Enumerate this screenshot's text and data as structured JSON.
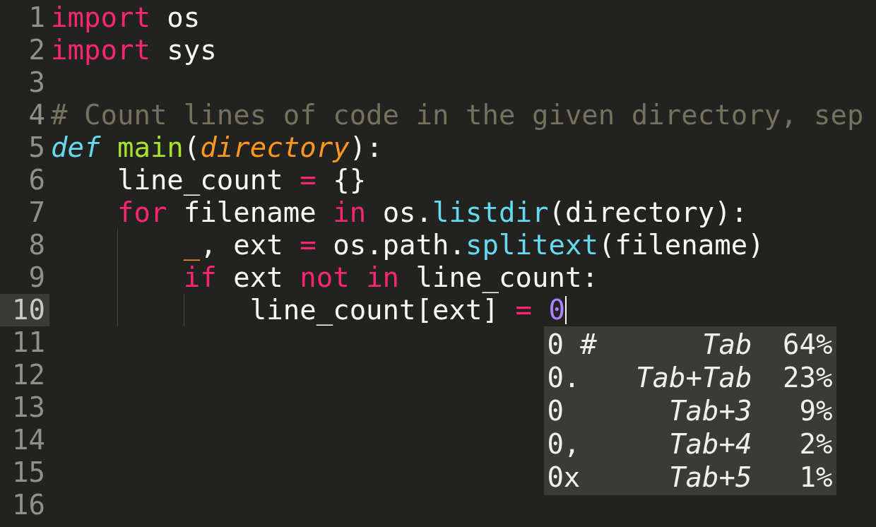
{
  "editor": {
    "lines": [
      {
        "number": "1",
        "current": false,
        "tokens": [
          {
            "text": "import",
            "kind": "keyword"
          },
          {
            "text": " os",
            "kind": "plain"
          }
        ]
      },
      {
        "number": "2",
        "current": false,
        "tokens": [
          {
            "text": "import",
            "kind": "keyword"
          },
          {
            "text": " sys",
            "kind": "plain"
          }
        ]
      },
      {
        "number": "3",
        "current": false
      },
      {
        "number": "4",
        "current": false,
        "tokens": [
          {
            "text": "# Count lines of code in the given directory, sep",
            "kind": "comment"
          }
        ]
      },
      {
        "number": "5",
        "current": false,
        "tokens": [
          {
            "text": "def ",
            "kind": "storage"
          },
          {
            "text": "main",
            "kind": "function"
          },
          {
            "text": "(",
            "kind": "plain"
          },
          {
            "text": "directory",
            "kind": "parameter"
          },
          {
            "text": "):",
            "kind": "plain"
          }
        ]
      },
      {
        "number": "6",
        "current": false,
        "tokens": [
          {
            "text": "    line_count ",
            "kind": "plain"
          },
          {
            "text": "=",
            "kind": "keyword"
          },
          {
            "text": " {}",
            "kind": "plain"
          }
        ]
      },
      {
        "number": "7",
        "current": false,
        "tokens": [
          {
            "text": "    for",
            "kind": "keyword"
          },
          {
            "text": " filename ",
            "kind": "plain"
          },
          {
            "text": "in",
            "kind": "keyword"
          },
          {
            "text": " os.",
            "kind": "plain"
          },
          {
            "text": "listdir",
            "kind": "support"
          },
          {
            "text": "(directory):",
            "kind": "plain"
          }
        ]
      },
      {
        "number": "8",
        "current": false,
        "tokens": [
          {
            "text": "        _",
            "kind": "variable"
          },
          {
            "text": ", ext ",
            "kind": "plain"
          },
          {
            "text": "=",
            "kind": "keyword"
          },
          {
            "text": " os.path.",
            "kind": "plain"
          },
          {
            "text": "splitext",
            "kind": "support"
          },
          {
            "text": "(filename)",
            "kind": "plain"
          }
        ]
      },
      {
        "number": "9",
        "current": false,
        "tokens": [
          {
            "text": "        if",
            "kind": "keyword"
          },
          {
            "text": " ext ",
            "kind": "plain"
          },
          {
            "text": "not in",
            "kind": "keyword"
          },
          {
            "text": " line_count:",
            "kind": "plain"
          }
        ]
      },
      {
        "number": "10",
        "current": true,
        "tokens": [
          {
            "text": "            line_count[ext] ",
            "kind": "plain"
          },
          {
            "text": "= ",
            "kind": "keyword"
          },
          {
            "text": "0",
            "kind": "number"
          }
        ]
      },
      {
        "number": "11",
        "current": false
      },
      {
        "number": "12",
        "current": false
      },
      {
        "number": "13",
        "current": false
      },
      {
        "number": "14",
        "current": false
      },
      {
        "number": "15",
        "current": false
      },
      {
        "number": "16",
        "current": false
      }
    ]
  },
  "autocomplete": {
    "items": [
      {
        "text": "0 #",
        "shortcut": "Tab",
        "probability": "64%"
      },
      {
        "text": "0.",
        "shortcut": "Tab+Tab",
        "probability": "23%"
      },
      {
        "text": "0",
        "shortcut": "Tab+3",
        "probability": "9%"
      },
      {
        "text": "0,",
        "shortcut": "Tab+4",
        "probability": "2%"
      },
      {
        "text": "0x",
        "shortcut": "Tab+5",
        "probability": "1%"
      }
    ]
  }
}
